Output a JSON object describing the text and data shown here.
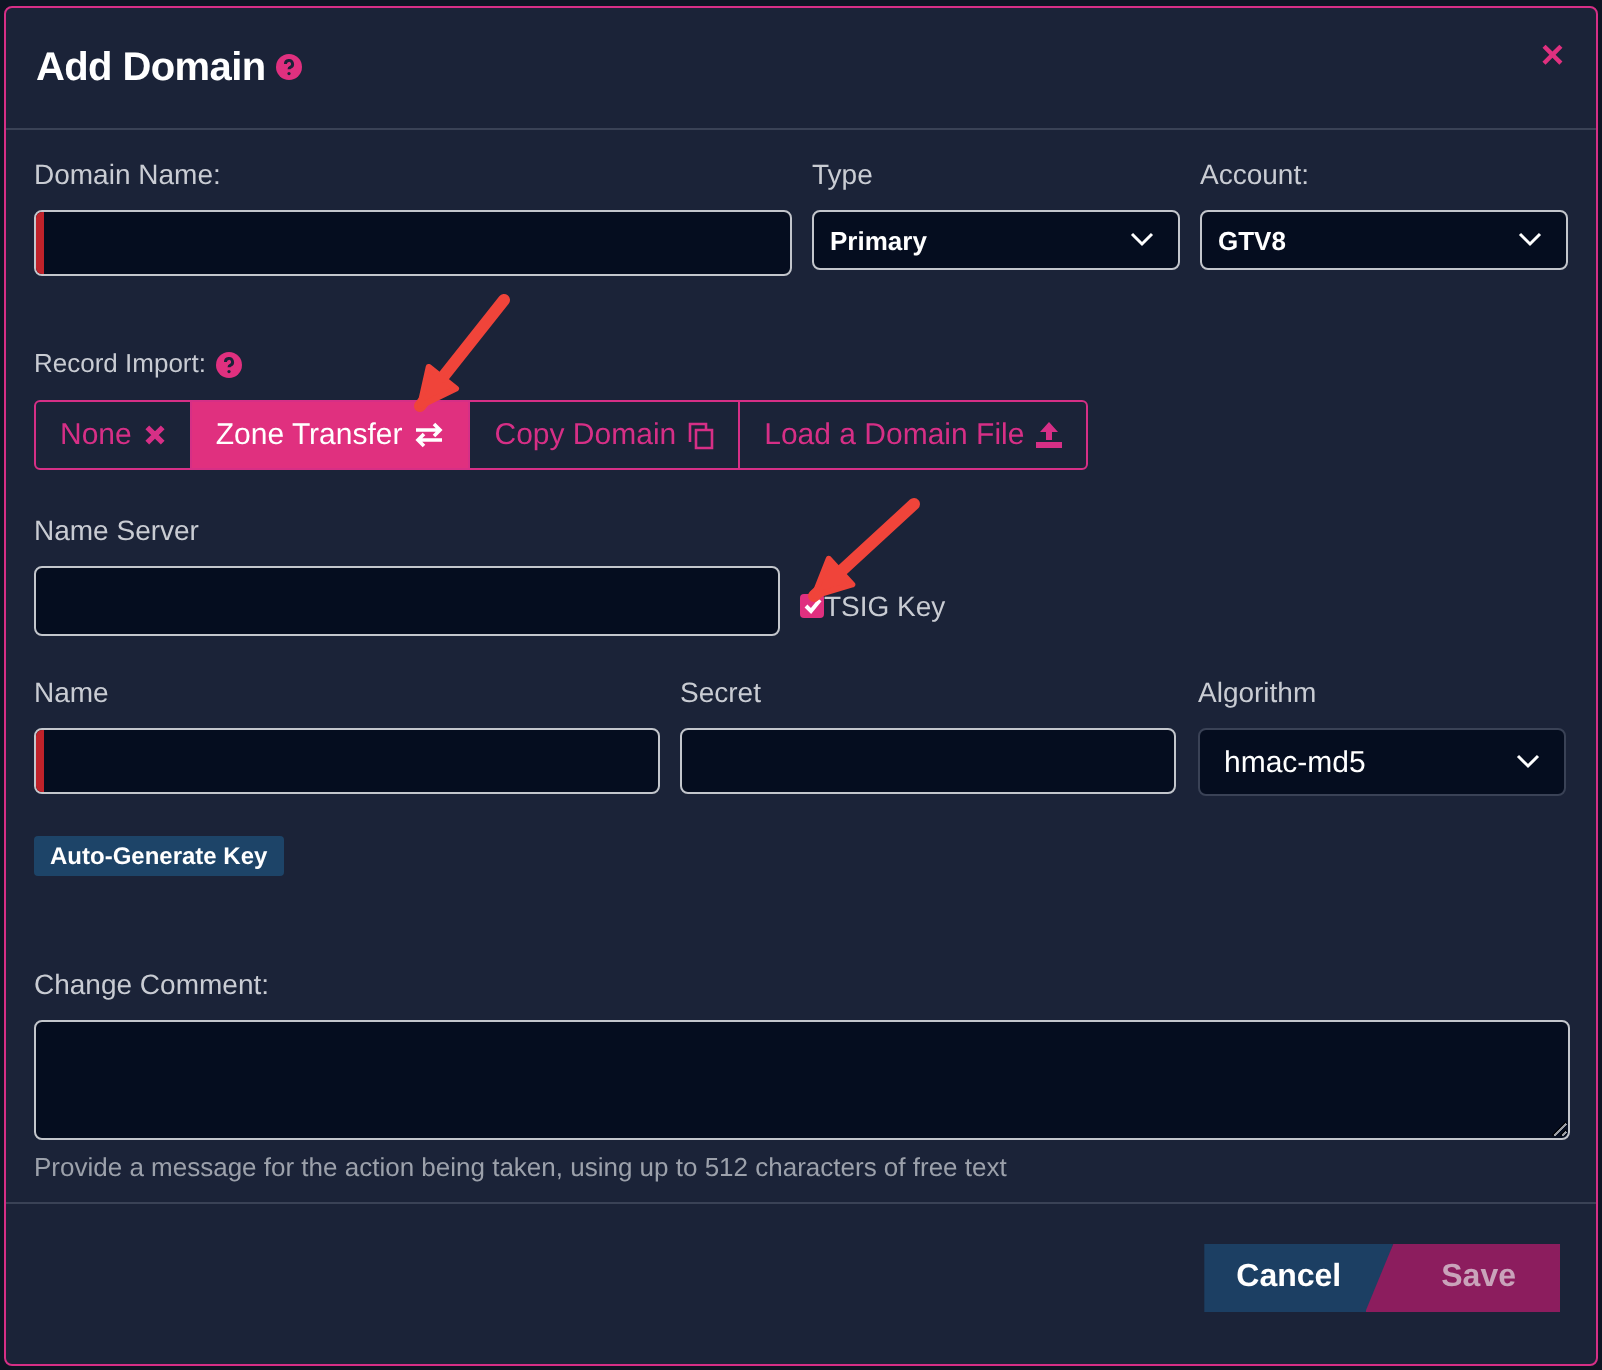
{
  "dialog": {
    "title": "Add Domain",
    "close": "×"
  },
  "domain_name": {
    "label": "Domain Name:",
    "required": true
  },
  "type": {
    "label": "Type",
    "value": "Primary"
  },
  "account": {
    "label": "Account:",
    "value": "GTV8"
  },
  "record_import": {
    "label": "Record Import:",
    "options": [
      {
        "label": "None",
        "selected": false
      },
      {
        "label": "Zone Transfer",
        "selected": true
      },
      {
        "label": "Copy Domain",
        "selected": false
      },
      {
        "label": "Load a Domain File",
        "selected": false
      }
    ]
  },
  "name_server": {
    "label": "Name Server",
    "required": false
  },
  "tsig_key": {
    "label": "TSIG Key",
    "checked": true
  },
  "tsig_fields": [
    {
      "kind": "input",
      "label": "Name",
      "required": true
    },
    {
      "kind": "input",
      "label": "Secret",
      "required": false
    },
    {
      "kind": "select",
      "label": "Algorithm",
      "value": "hmac-md5"
    }
  ],
  "auto_generate": "Auto-Generate Key",
  "change_comment": {
    "label": "Change Comment:",
    "hint": "Provide a message for the action being taken, using up to 512 characters of free text"
  },
  "buttons": [
    {
      "kind": "cancel",
      "label": "Cancel"
    },
    {
      "kind": "save",
      "label": "Save",
      "disabled": true
    }
  ]
}
